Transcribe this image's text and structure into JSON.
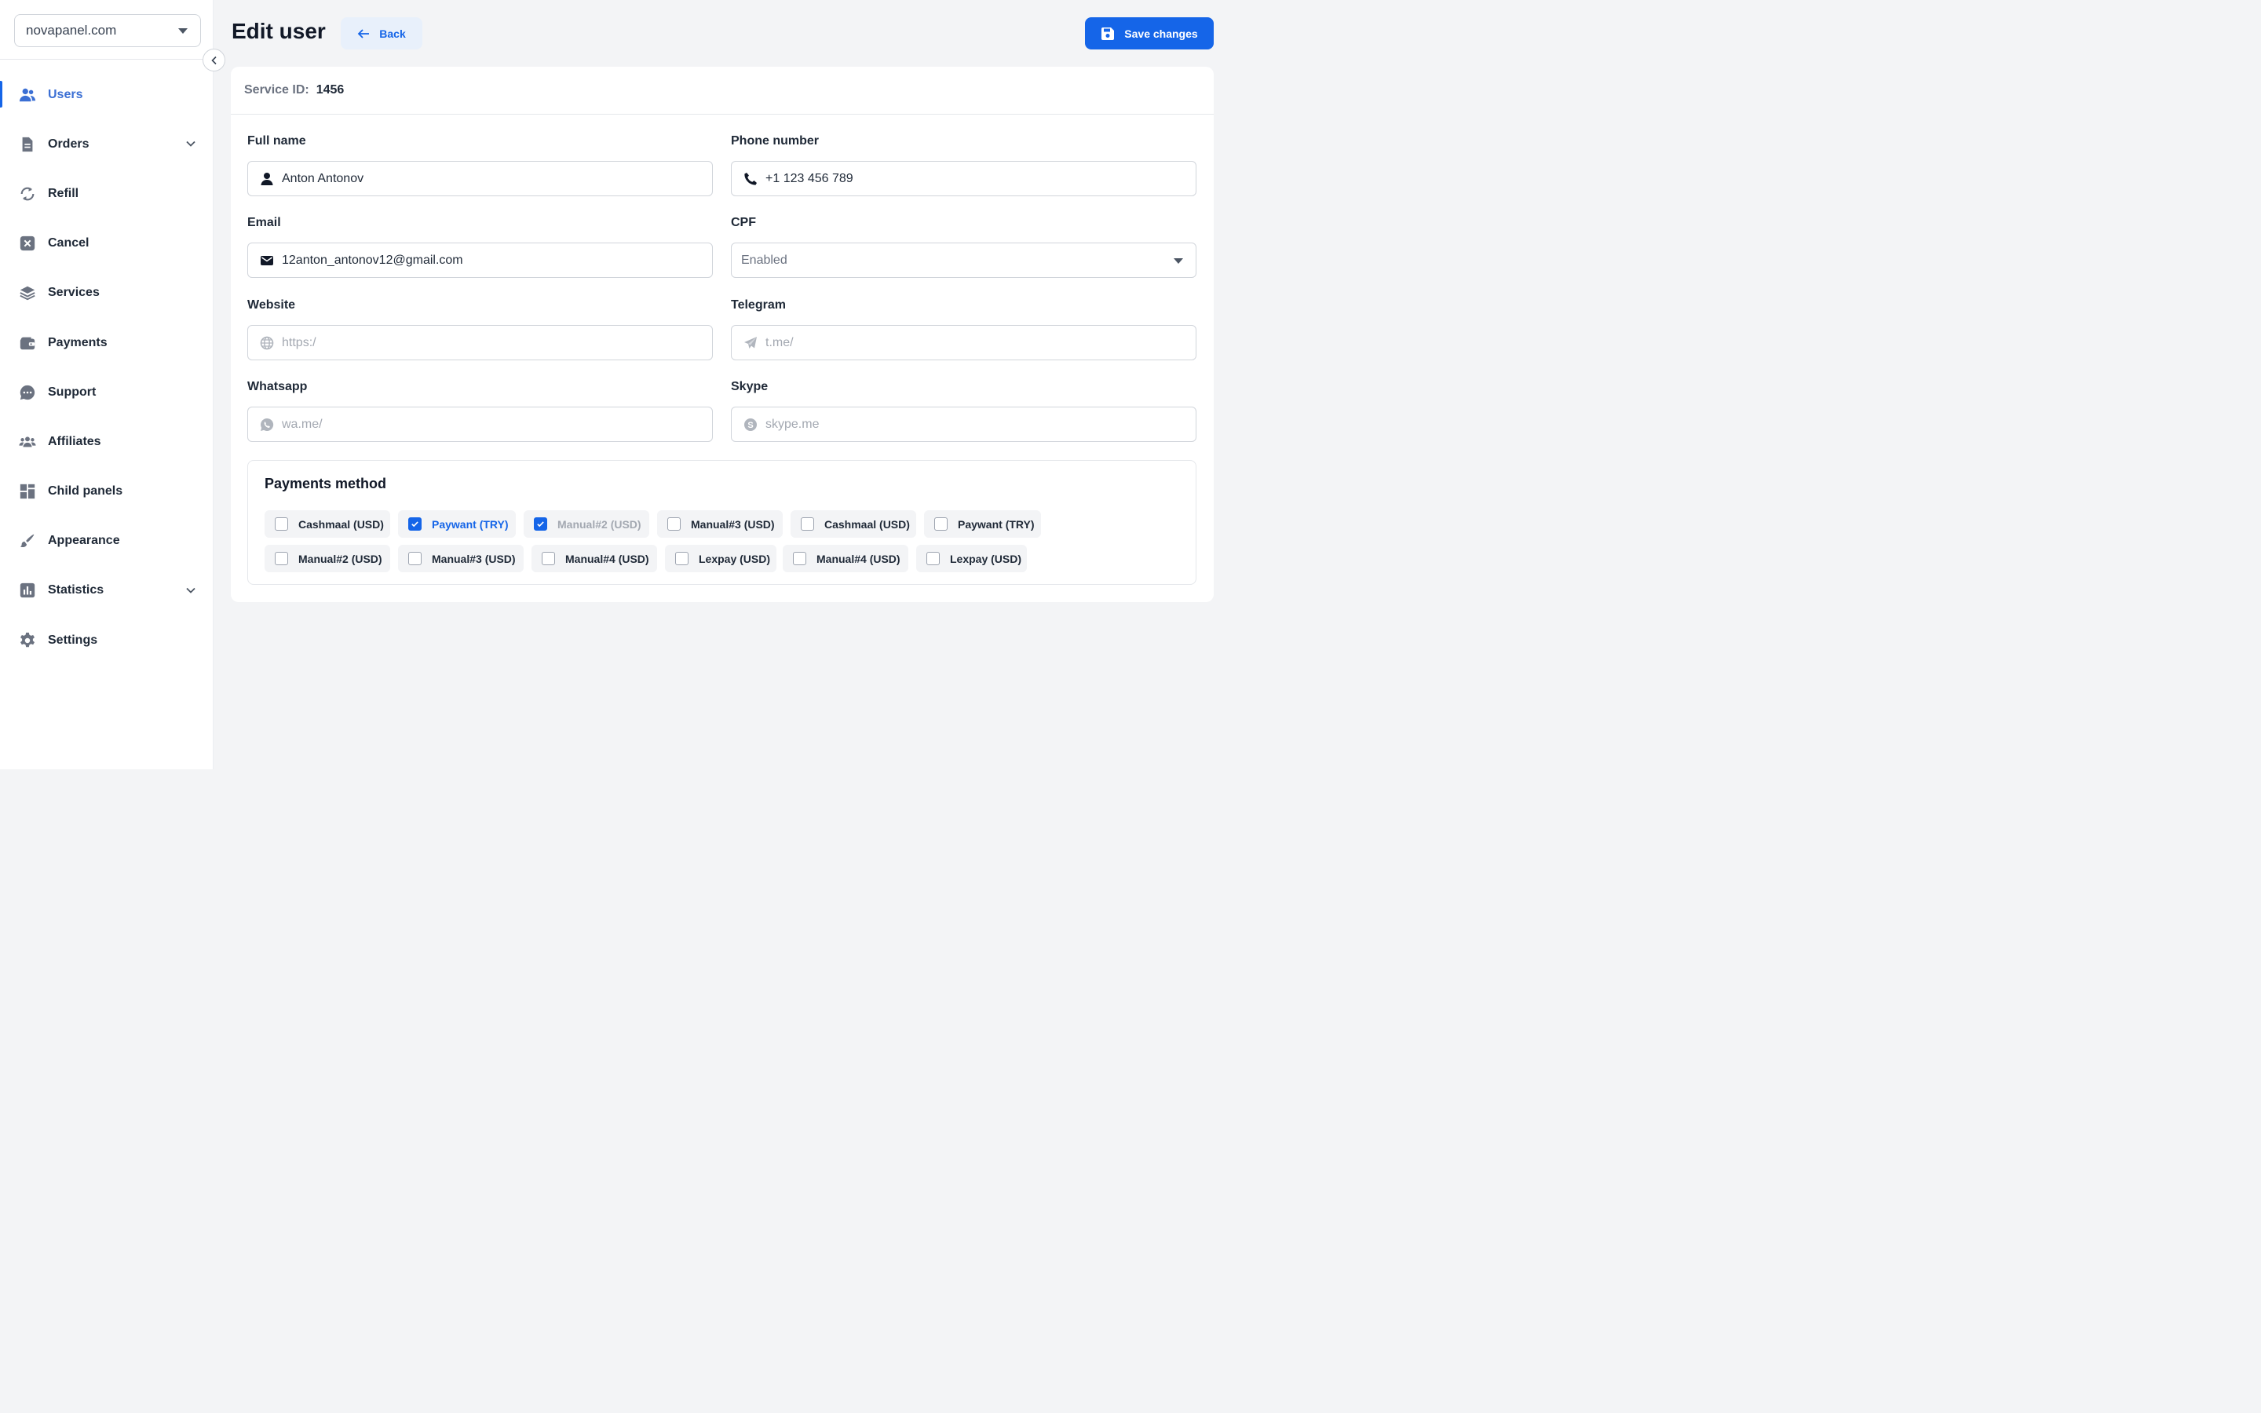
{
  "sidebar": {
    "domain": "novapanel.com",
    "items": [
      {
        "label": "Users",
        "icon": "users-icon",
        "active": true,
        "expandable": false
      },
      {
        "label": "Orders",
        "icon": "document-icon",
        "active": false,
        "expandable": true
      },
      {
        "label": "Refill",
        "icon": "refresh-icon",
        "active": false,
        "expandable": false
      },
      {
        "label": "Cancel",
        "icon": "cancel-icon",
        "active": false,
        "expandable": false
      },
      {
        "label": "Services",
        "icon": "layers-icon",
        "active": false,
        "expandable": false
      },
      {
        "label": "Payments",
        "icon": "wallet-icon",
        "active": false,
        "expandable": false
      },
      {
        "label": "Support",
        "icon": "chat-icon",
        "active": false,
        "expandable": false
      },
      {
        "label": "Affiliates",
        "icon": "group-icon",
        "active": false,
        "expandable": false
      },
      {
        "label": "Child panels",
        "icon": "grid-icon",
        "active": false,
        "expandable": false
      },
      {
        "label": "Appearance",
        "icon": "brush-icon",
        "active": false,
        "expandable": false
      },
      {
        "label": "Statistics",
        "icon": "chart-icon",
        "active": false,
        "expandable": true
      },
      {
        "label": "Settings",
        "icon": "gear-icon",
        "active": false,
        "expandable": false
      }
    ]
  },
  "header": {
    "title": "Edit user",
    "back_label": "Back",
    "save_label": "Save changes"
  },
  "service": {
    "label": "Service ID:",
    "value": "1456"
  },
  "form": {
    "full_name": {
      "label": "Full name",
      "value": "Anton Antonov"
    },
    "phone": {
      "label": "Phone number",
      "value": "+1 123 456 789"
    },
    "email": {
      "label": "Email",
      "value": "12anton_antonov12@gmail.com"
    },
    "cpf": {
      "label": "CPF",
      "value": "Enabled"
    },
    "website": {
      "label": "Website",
      "placeholder": "https:/"
    },
    "telegram": {
      "label": "Telegram",
      "placeholder": "t.me/"
    },
    "whatsapp": {
      "label": "Whatsapp",
      "placeholder": "wa.me/"
    },
    "skype": {
      "label": "Skype",
      "placeholder": "skype.me"
    }
  },
  "payments": {
    "title": "Payments method",
    "methods": [
      {
        "label": "Cashmaal (USD)",
        "checked": false,
        "state": "normal"
      },
      {
        "label": "Paywant (TRY)",
        "checked": true,
        "state": "active"
      },
      {
        "label": "Manual#2 (USD)",
        "checked": true,
        "state": "disabled"
      },
      {
        "label": "Manual#3 (USD)",
        "checked": false,
        "state": "normal"
      },
      {
        "label": "Cashmaal (USD)",
        "checked": false,
        "state": "normal"
      },
      {
        "label": "Paywant (TRY)",
        "checked": false,
        "state": "normal"
      },
      {
        "label": "Manual#2 (USD)",
        "checked": false,
        "state": "normal"
      },
      {
        "label": "Manual#3 (USD)",
        "checked": false,
        "state": "normal"
      },
      {
        "label": "Manual#4 (USD)",
        "checked": false,
        "state": "normal"
      },
      {
        "label": "Lexpay (USD)",
        "checked": false,
        "state": "normal"
      },
      {
        "label": "Manual#4 (USD)",
        "checked": false,
        "state": "normal"
      },
      {
        "label": "Lexpay (USD)",
        "checked": false,
        "state": "normal"
      }
    ]
  },
  "colors": {
    "accent": "#1565e8",
    "active_nav": "#3b6fd4",
    "background": "#f3f4f6"
  }
}
